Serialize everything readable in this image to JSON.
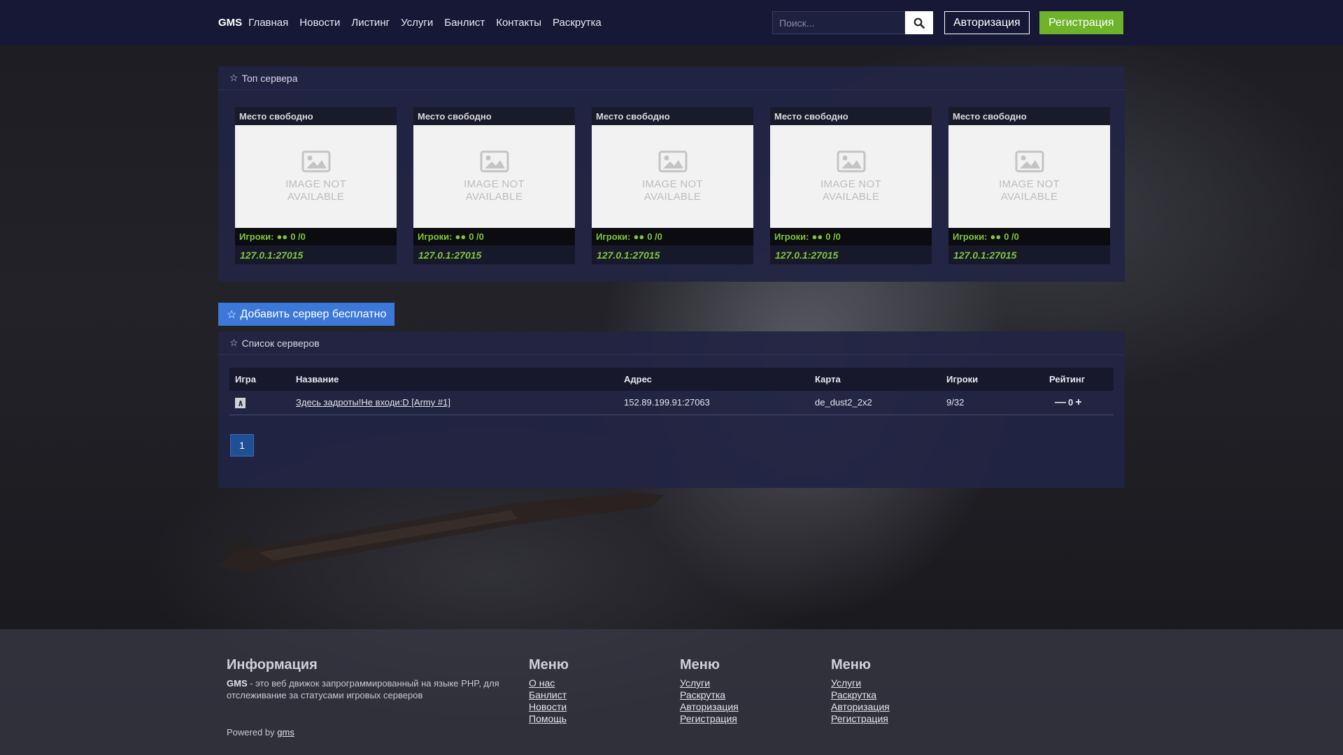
{
  "nav": {
    "brand": "GMS",
    "links": [
      "Главная",
      "Новости",
      "Листинг",
      "Услуги",
      "Банлист",
      "Контакты",
      "Раскрутка"
    ],
    "search_placeholder": "Поиск...",
    "login_label": "Авторизация",
    "register_label": "Регистрация",
    "register_color": "#6fb32a"
  },
  "top_servers": {
    "title": "Топ сервера",
    "cards": [
      {
        "title": "Место свободно",
        "image_text_1": "IMAGE NOT",
        "image_text_2": "AVAILABLE",
        "players_label": "Игроки:",
        "players": "0 /0",
        "ip": "127.0.1:27015"
      },
      {
        "title": "Место свободно",
        "image_text_1": "IMAGE NOT",
        "image_text_2": "AVAILABLE",
        "players_label": "Игроки:",
        "players": "0 /0",
        "ip": "127.0.1:27015"
      },
      {
        "title": "Место свободно",
        "image_text_1": "IMAGE NOT",
        "image_text_2": "AVAILABLE",
        "players_label": "Игроки:",
        "players": "0 /0",
        "ip": "127.0.1:27015"
      },
      {
        "title": "Место свободно",
        "image_text_1": "IMAGE NOT",
        "image_text_2": "AVAILABLE",
        "players_label": "Игроки:",
        "players": "0 /0",
        "ip": "127.0.1:27015"
      },
      {
        "title": "Место свободно",
        "image_text_1": "IMAGE NOT",
        "image_text_2": "AVAILABLE",
        "players_label": "Игроки:",
        "players": "0 /0",
        "ip": "127.0.1:27015"
      }
    ]
  },
  "add_server_label": "Добавить сервер бесплатно",
  "server_list": {
    "title": "Список серверов",
    "columns": [
      "Игра",
      "Название",
      "Адрес",
      "Карта",
      "Игроки",
      "Рейтинг"
    ],
    "rows": [
      {
        "name": "Здесь задроты!Не входи:D [Army #1]",
        "address": "152.89.199.91:27063",
        "map": "de_dust2_2x2",
        "players": "9/32",
        "rating": "0"
      }
    ],
    "pages": [
      "1"
    ]
  },
  "footer": {
    "info_title": "Информация",
    "info_brand": "GMS",
    "info_text": " - это веб движок запрограммированный на языке PHP, для отслеживание за статусами игровых серверов",
    "menu1": {
      "title": "Меню",
      "links": [
        "О нас",
        "Банлист",
        "Новости",
        "Помощь"
      ]
    },
    "menu2": {
      "title": "Меню",
      "links": [
        "Услуги",
        "Раскрутка",
        "Авторизация",
        "Регистрация"
      ]
    },
    "menu3": {
      "title": "Меню",
      "links": [
        "Услуги",
        "Раскрутка",
        "Авторизация",
        "Регистрация"
      ]
    },
    "powered_prefix": "Powered by ",
    "powered_link": "gms"
  },
  "icons": {
    "star": "star-icon",
    "search": "search-icon",
    "players": "users-icon",
    "image": "image-placeholder-icon"
  }
}
